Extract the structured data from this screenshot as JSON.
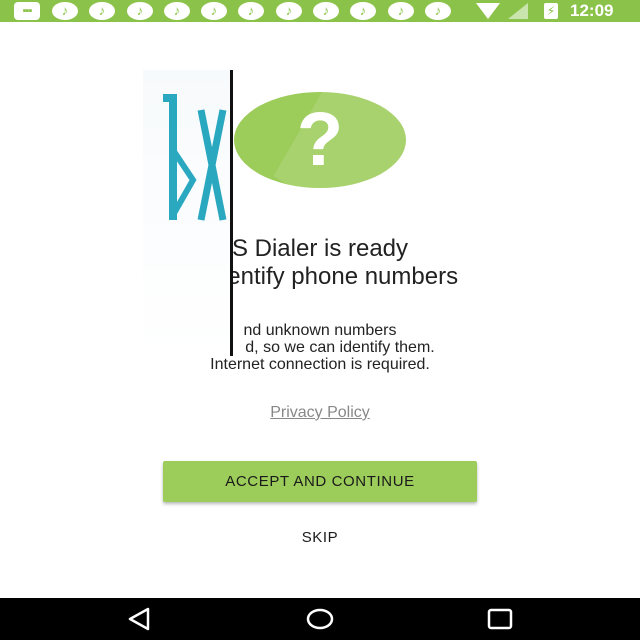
{
  "status_bar": {
    "time": "12:09",
    "notification_icons": [
      "keyboard-icon",
      "music-note-icon",
      "music-note-icon",
      "music-note-icon",
      "music-note-icon",
      "music-note-icon",
      "music-note-icon",
      "music-note-icon",
      "music-note-icon",
      "music-note-icon",
      "music-note-icon",
      "music-note-icon"
    ],
    "wifi_icon": "wifi-icon",
    "signal_icon": "signal-icon",
    "battery_icon": "battery-charging-icon"
  },
  "onboarding": {
    "logo_icon": "help-question-icon",
    "logo_glyph": "?",
    "headline_line1": "S Dialer is ready",
    "headline_line2": "to identify phone numbers",
    "body_line1": "nd unknown numbers",
    "body_line2": "to      d, so we can identify them.",
    "body_line3": "Internet connection is required.",
    "privacy_link": "Privacy Policy",
    "accept_button": "ACCEPT AND CONTINUE",
    "skip_button": "SKIP"
  },
  "nav_bar": {
    "back_icon": "back-triangle-icon",
    "home_icon": "home-circle-icon",
    "recents_icon": "recents-square-icon"
  },
  "colors": {
    "accent_green": "#9ccc5a",
    "status_bar_green": "#8bc34a",
    "text_dark": "#222222",
    "link_gray": "#888888",
    "nav_bar_black": "#000000"
  }
}
